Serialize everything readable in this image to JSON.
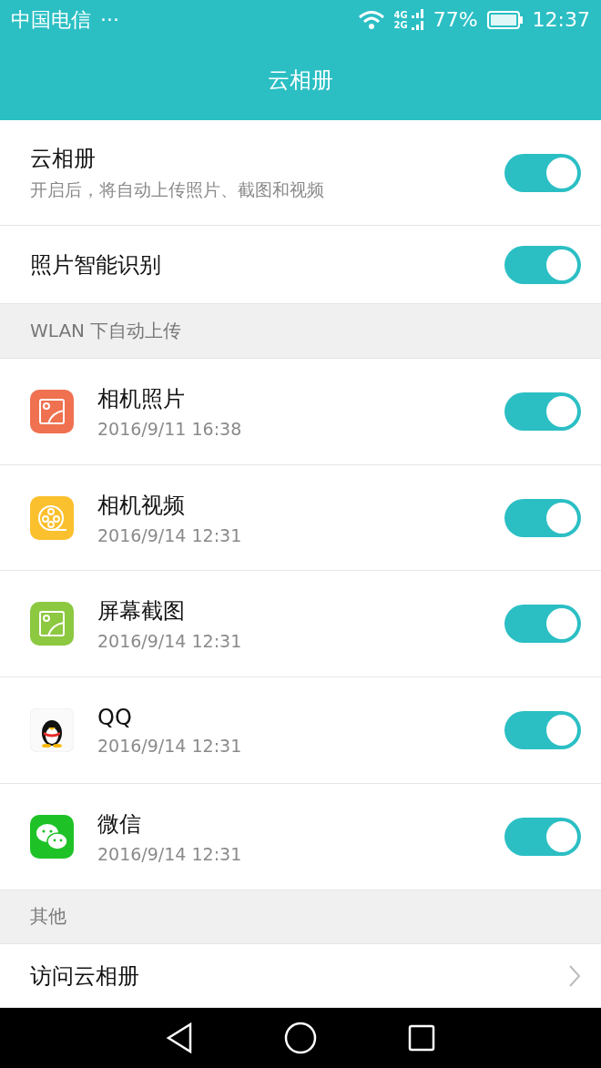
{
  "status_bar": {
    "carrier": "中国电信",
    "more": "···",
    "net_top": "4G",
    "net_bottom": "2G",
    "battery": "77%",
    "time": "12:37"
  },
  "title": "云相册",
  "settings": [
    {
      "label": "云相册",
      "description": "开启后，将自动上传照片、截图和视频",
      "on": true
    },
    {
      "label": "照片智能识别",
      "on": true
    }
  ],
  "wlan_section": {
    "header": "WLAN 下自动上传",
    "items": [
      {
        "kind": "photo",
        "label": "相机照片",
        "date": "2016/9/11 16:38",
        "on": true
      },
      {
        "kind": "video",
        "label": "相机视频",
        "date": "2016/9/14 12:31",
        "on": true
      },
      {
        "kind": "screenshot",
        "label": "屏幕截图",
        "date": "2016/9/14 12:31",
        "on": true
      },
      {
        "kind": "penguin",
        "label": "QQ",
        "date": "2016/9/14 12:31",
        "on": true
      },
      {
        "kind": "chat",
        "label": "微信",
        "date": "2016/9/14 12:31",
        "on": true
      }
    ]
  },
  "other_section": {
    "header": "其他",
    "items": [
      {
        "label": "访问云相册"
      }
    ]
  }
}
